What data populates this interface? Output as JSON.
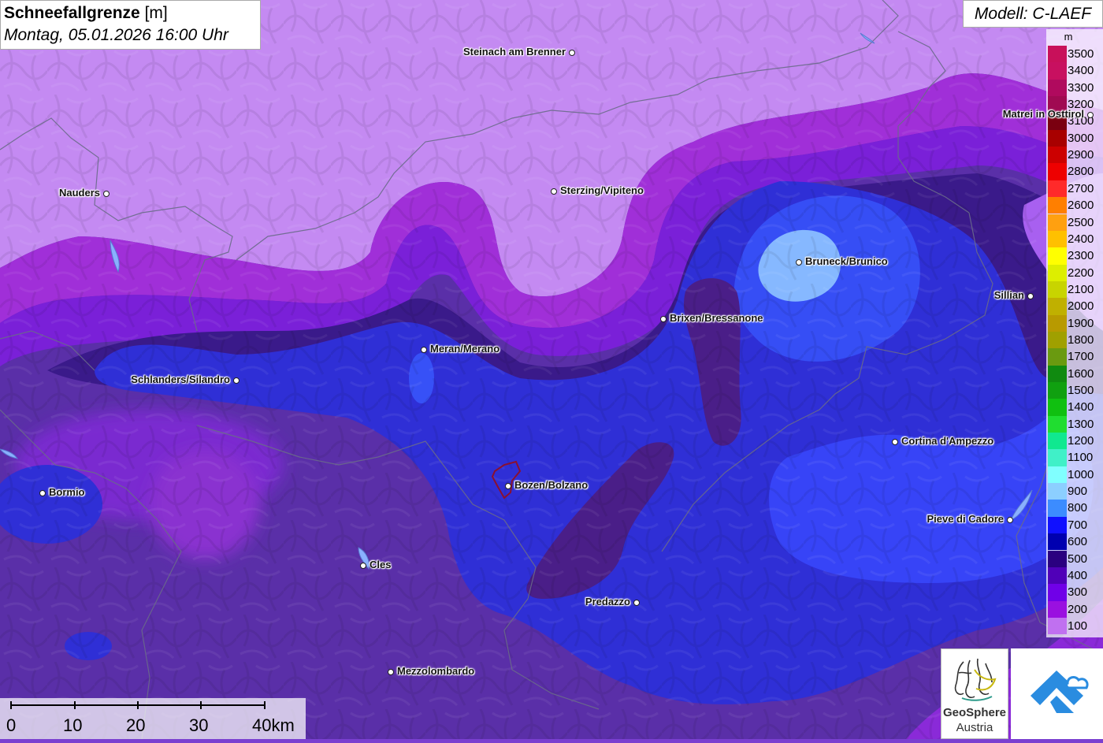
{
  "title": {
    "bold": "Schneefallgrenze",
    "unit": " [m]",
    "datetime": "Montag, 05.01.2026 16:00 Uhr"
  },
  "model": "Modell: C-LAEF",
  "legend": {
    "unit": "m",
    "levels": [
      {
        "label": "3500",
        "color": "#c8105a"
      },
      {
        "label": "3400",
        "color": "#c81060"
      },
      {
        "label": "3300",
        "color": "#b00a5e"
      },
      {
        "label": "3200",
        "color": "#a00a52"
      },
      {
        "label": "3100",
        "color": "#7a0010"
      },
      {
        "label": "3000",
        "color": "#a80000"
      },
      {
        "label": "2900",
        "color": "#cc0000"
      },
      {
        "label": "2800",
        "color": "#ee0000"
      },
      {
        "label": "2700",
        "color": "#ff2a2a"
      },
      {
        "label": "2600",
        "color": "#ff7f00"
      },
      {
        "label": "2500",
        "color": "#ffa010"
      },
      {
        "label": "2400",
        "color": "#ffc000"
      },
      {
        "label": "2300",
        "color": "#ffff00"
      },
      {
        "label": "2200",
        "color": "#ddee00"
      },
      {
        "label": "2100",
        "color": "#c8d400"
      },
      {
        "label": "2000",
        "color": "#c0b000"
      },
      {
        "label": "1900",
        "color": "#b89a00"
      },
      {
        "label": "1800",
        "color": "#a0a000"
      },
      {
        "label": "1700",
        "color": "#6a9a10"
      },
      {
        "label": "1600",
        "color": "#108a10"
      },
      {
        "label": "1500",
        "color": "#10a010"
      },
      {
        "label": "1400",
        "color": "#10c010"
      },
      {
        "label": "1300",
        "color": "#20dd30"
      },
      {
        "label": "1200",
        "color": "#10e890"
      },
      {
        "label": "1100",
        "color": "#40f0c8"
      },
      {
        "label": "1000",
        "color": "#80ffff"
      },
      {
        "label": "900",
        "color": "#8ccfff"
      },
      {
        "label": "800",
        "color": "#3c8cff"
      },
      {
        "label": "700",
        "color": "#1010ff"
      },
      {
        "label": "600",
        "color": "#0000b0"
      },
      {
        "label": "500",
        "color": "#2a0080"
      },
      {
        "label": "400",
        "color": "#5000b8"
      },
      {
        "label": "300",
        "color": "#7000e8"
      },
      {
        "label": "200",
        "color": "#9a10e0"
      },
      {
        "label": "100",
        "color": "#c070f0"
      }
    ]
  },
  "scale": {
    "labels": [
      "0",
      "10",
      "20",
      "30",
      "40km"
    ]
  },
  "cities": [
    {
      "name": "Steinach am Brenner",
      "side": "left"
    },
    {
      "name": "Nauders",
      "side": "left"
    },
    {
      "name": "Sterzing/Vipiteno",
      "side": "right"
    },
    {
      "name": "Matrei in Osttirol",
      "side": "left"
    },
    {
      "name": "Bruneck/Brunico",
      "side": "right"
    },
    {
      "name": "Sillian",
      "side": "left"
    },
    {
      "name": "Brixen/Bressanone",
      "side": "right"
    },
    {
      "name": "Meran/Merano",
      "side": "right"
    },
    {
      "name": "Schlanders/Silandro",
      "side": "left"
    },
    {
      "name": "Cortina d'Ampezzo",
      "side": "right"
    },
    {
      "name": "Bormio",
      "side": "right"
    },
    {
      "name": "Bozen/Bolzano",
      "side": "right"
    },
    {
      "name": "Pieve di Cadore",
      "side": "left"
    },
    {
      "name": "Cles",
      "side": "right"
    },
    {
      "name": "Predazzo",
      "side": "left"
    },
    {
      "name": "Mezzolombardo",
      "side": "right"
    }
  ],
  "logos": {
    "geosphere_line1": "GeoSphere",
    "geosphere_line2": "Austria"
  }
}
